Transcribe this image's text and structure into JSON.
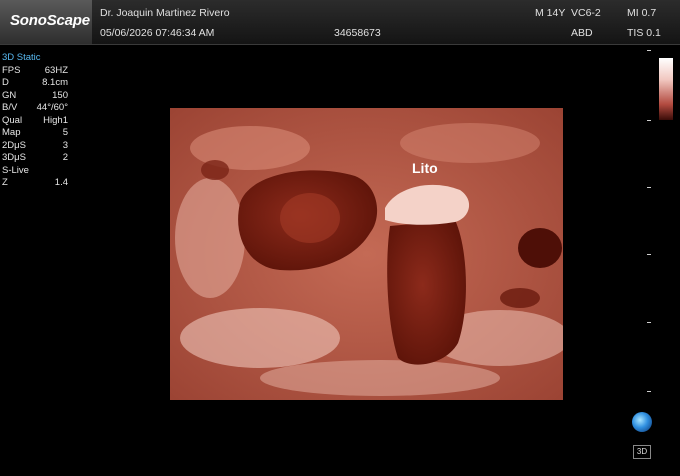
{
  "header": {
    "logo": "SonoScape",
    "doctor": "Dr. Joaquin Martinez Rivero",
    "datetime": "05/06/2026 07:46:34 AM",
    "patient_id": "34658673",
    "age": "M 14Y",
    "probe": "VC6-2",
    "mi": "MI 0.7",
    "preset": "ABD",
    "tis": "TIS 0.1"
  },
  "params": {
    "mode": "3D Static",
    "rows": [
      {
        "label": "FPS",
        "value": "63HZ"
      },
      {
        "label": "D",
        "value": "8.1cm"
      },
      {
        "label": "GN",
        "value": "150"
      },
      {
        "label": "B/V",
        "value": "44°/60°"
      },
      {
        "label": "Qual",
        "value": "High1"
      },
      {
        "label": "Map",
        "value": "5"
      },
      {
        "label": "2DμS",
        "value": "3"
      },
      {
        "label": "3DμS",
        "value": "2"
      },
      {
        "label": "S-Live",
        "value": ""
      },
      {
        "label": "Z",
        "value": "1.4"
      }
    ]
  },
  "image": {
    "annotation": "Lito"
  },
  "probe_icon_label": "3D",
  "colors": {
    "background": "#000000",
    "tissue": "#b05a46",
    "cavity": "#7a1e12",
    "highlight": "#f4d2c8",
    "mode_text": "#58b8f0"
  }
}
